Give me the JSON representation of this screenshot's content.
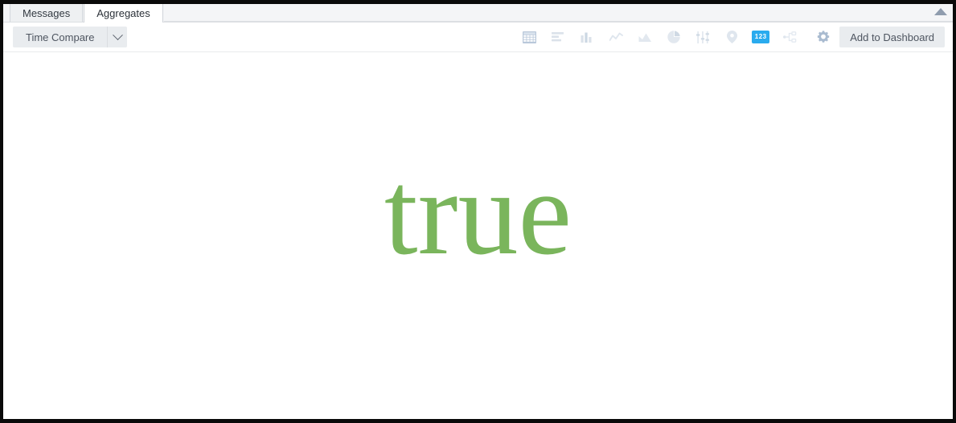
{
  "window": {
    "collapse_caret_icon": "caret-up-icon"
  },
  "tabs": [
    {
      "label": "Messages",
      "active": false
    },
    {
      "label": "Aggregates",
      "active": true
    }
  ],
  "toolbar": {
    "time_compare_label": "Time Compare",
    "time_compare_caret_icon": "chevron-down-icon",
    "add_to_dashboard_label": "Add to Dashboard",
    "gear_icon": "gear-icon",
    "numeric_icon_label": "123",
    "accent_color": "#2aabee",
    "viz_icons": [
      {
        "name": "table-icon",
        "title": "Table"
      },
      {
        "name": "bar-chart-horizontal-icon",
        "title": "Horizontal Bar Chart"
      },
      {
        "name": "bar-chart-icon",
        "title": "Bar Chart"
      },
      {
        "name": "line-chart-icon",
        "title": "Line Chart"
      },
      {
        "name": "area-chart-icon",
        "title": "Area Chart"
      },
      {
        "name": "pie-chart-icon",
        "title": "Pie Chart"
      },
      {
        "name": "sliders-icon",
        "title": "Gauge"
      },
      {
        "name": "map-pin-icon",
        "title": "Map"
      },
      {
        "name": "numeric-icon",
        "title": "Single Value"
      },
      {
        "name": "node-graph-icon",
        "title": "Node Graph"
      }
    ]
  },
  "result": {
    "value": "true",
    "value_color": "#7ab55c"
  }
}
